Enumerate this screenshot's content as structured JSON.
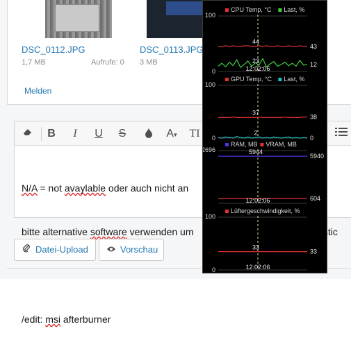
{
  "attachments": [
    {
      "name": "DSC_0112.JPG",
      "size": "1,7 MB",
      "views": "Aufrufe: 0"
    },
    {
      "name": "DSC_0113.JPG",
      "size": "3 MB"
    }
  ],
  "report_link": "Melden",
  "editor": {
    "toolbar": {
      "eraser_icon": "eraser-icon",
      "bold": "B",
      "italic": "I",
      "underline": "U",
      "strike": "S",
      "color_icon": "droplet-icon",
      "font_size": "A",
      "text_format": "TI",
      "list_icon": "list-icon"
    },
    "lines": [
      [
        "N/A",
        " = not ",
        "avaylable",
        " oder auch nicht an"
      ],
      [
        "bitte alternative ",
        "software",
        " verwenden um",
        "",
        "",
        "n (stic"
      ],
      [],
      [
        "/edit: ",
        "msi",
        " afterburner"
      ]
    ]
  },
  "buttons": {
    "upload": "Datei-Upload",
    "preview": "Vorschau"
  },
  "monitor": {
    "graphs": [
      {
        "title": "CPU Temp, °C",
        "legend": [
          "Last, %"
        ],
        "colors": [
          "#e03030",
          "#40d040"
        ],
        "y_max": "100",
        "y_min": "0",
        "cursor_time": "12:02:06",
        "cursor_values": [
          "44",
          "23"
        ],
        "right_values": [
          "43",
          "12"
        ],
        "series": [
          {
            "name": "CPU Temp, °C",
            "values": [
              43,
              43,
              44,
              43,
              44,
              43,
              43,
              44,
              44,
              43,
              43,
              44,
              43,
              44,
              43,
              43,
              44,
              43,
              43,
              44,
              43,
              43,
              44,
              43,
              43
            ]
          },
          {
            "name": "Last, %",
            "values": [
              9,
              14,
              8,
              16,
              10,
              20,
              7,
              12,
              18,
              9,
              15,
              11,
              22,
              8,
              13,
              17,
              9,
              12,
              16,
              10,
              14,
              9,
              19,
              11,
              12
            ]
          }
        ]
      },
      {
        "title": "GPU Temp, °C",
        "legend": [
          "Last, %"
        ],
        "colors": [
          "#e03030",
          "#20c0c8"
        ],
        "y_max": "100",
        "y_min": "0",
        "cursor_time": "",
        "cursor_values": [
          "37",
          "2"
        ],
        "right_values": [
          "38",
          "0"
        ],
        "series": [
          {
            "name": "GPU Temp, °C",
            "values": [
              37,
              37,
              37,
              37,
              38,
              37,
              37,
              37,
              37,
              37,
              37,
              38,
              37,
              37,
              37,
              37,
              37,
              37,
              38,
              37,
              37,
              37,
              37,
              38,
              38
            ]
          },
          {
            "name": "Last, %",
            "values": [
              1,
              0,
              2,
              1,
              0,
              3,
              1,
              0,
              2,
              0,
              1,
              2,
              0,
              1,
              0,
              2,
              1,
              0,
              1,
              2,
              0,
              1,
              0,
              1,
              0
            ]
          }
        ]
      },
      {
        "title": "RAM, MB",
        "legend": [
          "VRAM, MB"
        ],
        "colors": [
          "#5030e0",
          "#e03030"
        ],
        "y_max": "2696",
        "y_min": "",
        "cursor_time": "12:02:06",
        "cursor_values": [
          "5944",
          ""
        ],
        "right_values": [
          "5940",
          "604"
        ],
        "series": [
          {
            "name": "RAM, MB",
            "values": [
              5944,
              5944,
              5944,
              5944,
              5944,
              5944,
              5944,
              5944,
              5944,
              5944,
              5944,
              5944,
              5944,
              5944,
              5944,
              5944,
              5944,
              5944,
              5944,
              5944,
              5944,
              5944,
              5944,
              5940,
              5940
            ]
          },
          {
            "name": "VRAM, MB",
            "values": [
              604,
              604,
              604,
              604,
              604,
              604,
              604,
              604,
              604,
              604,
              604,
              604,
              604,
              604,
              604,
              604,
              604,
              604,
              604,
              604,
              604,
              604,
              604,
              604,
              604
            ]
          }
        ]
      },
      {
        "title": "Lüftergeschwindigkeit, %",
        "legend": [],
        "colors": [
          "#e03030"
        ],
        "y_max": "100",
        "y_min": "0",
        "cursor_time": "12:02:06",
        "cursor_values": [
          "33"
        ],
        "right_values": [
          "33"
        ],
        "series": [
          {
            "name": "Lüftergeschwindigkeit, %",
            "values": [
              33,
              33,
              33,
              33,
              33,
              33,
              33,
              33,
              33,
              33,
              33,
              33,
              33,
              33,
              33,
              33,
              33,
              33,
              33,
              33,
              33,
              33,
              33,
              33,
              33
            ]
          }
        ]
      }
    ]
  }
}
